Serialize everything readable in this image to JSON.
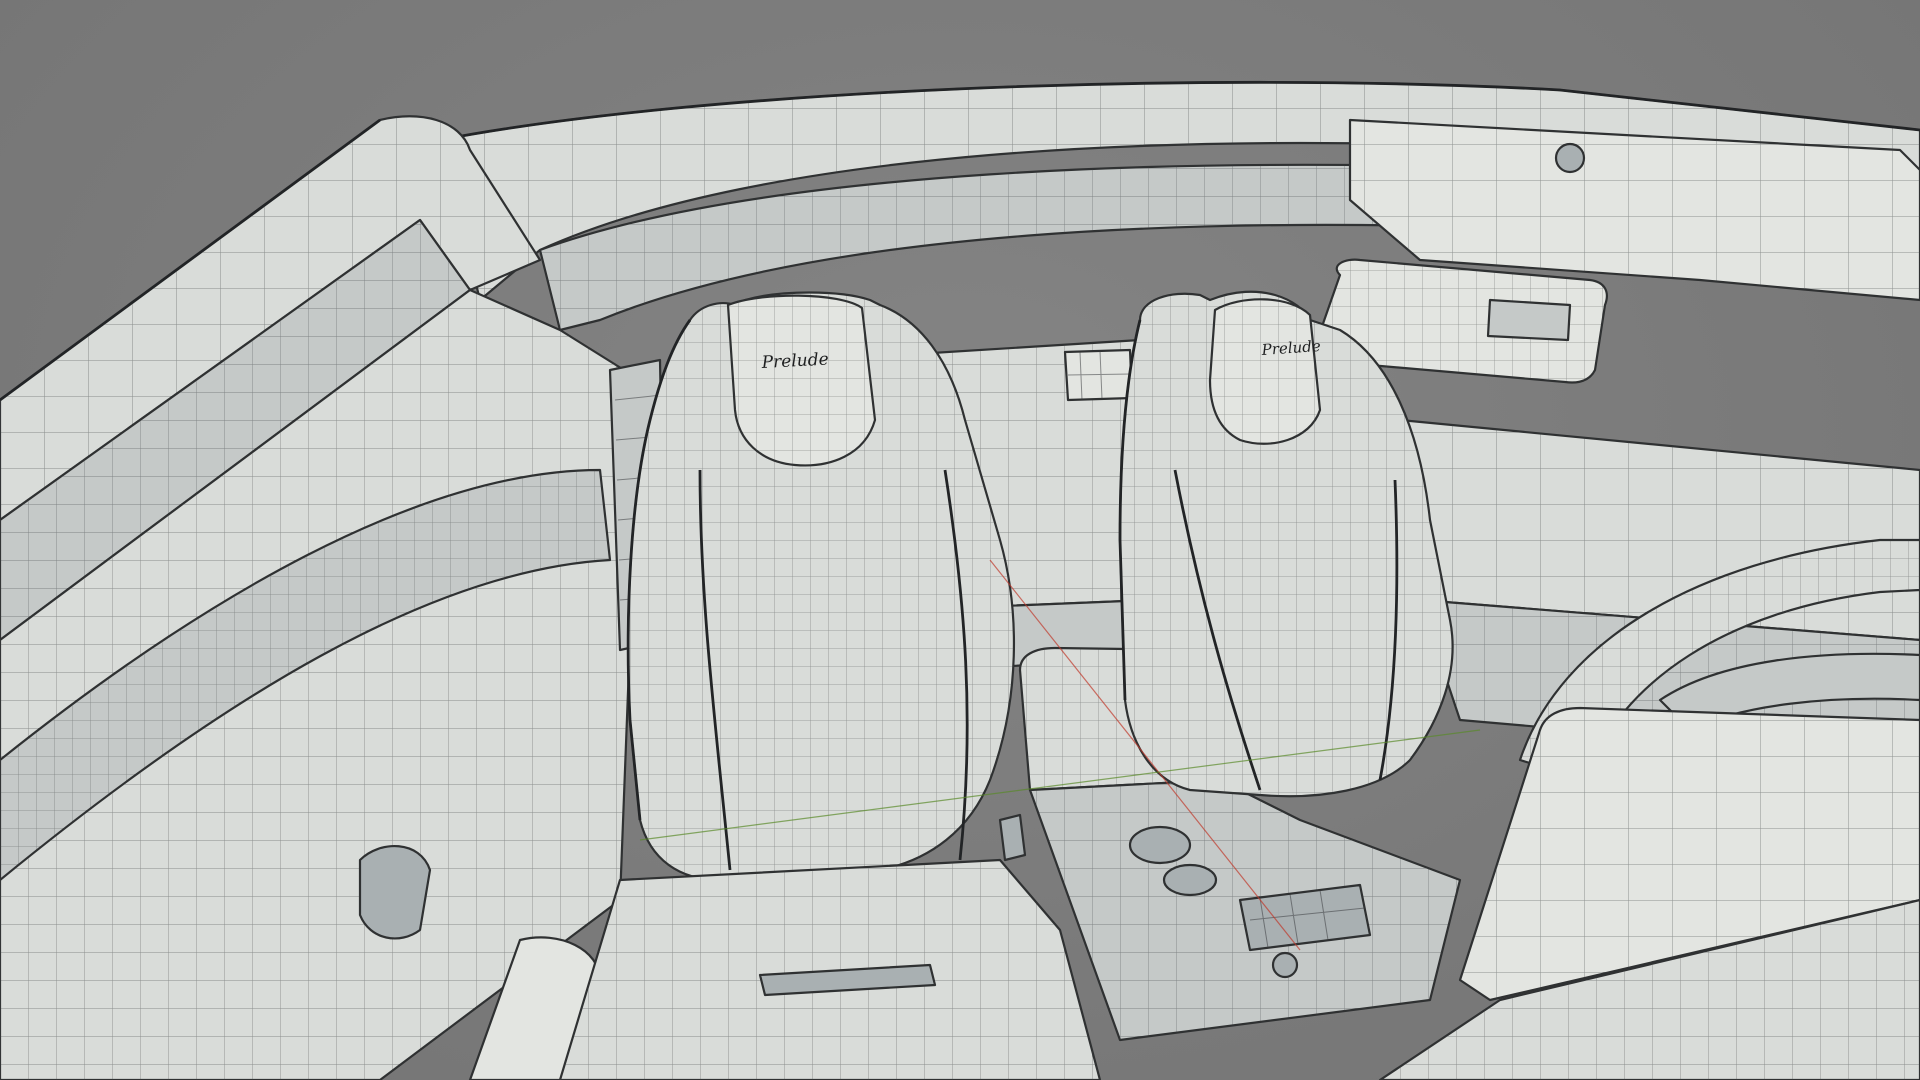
{
  "scene": {
    "seat_badge_left": "Prelude",
    "seat_badge_right": "Prelude"
  },
  "colors": {
    "background": "#7c7c7c",
    "surface": "#d9dcd9",
    "wire": "#2f3132",
    "axis_x": "#c0392b",
    "axis_y": "#5a8a2a"
  }
}
